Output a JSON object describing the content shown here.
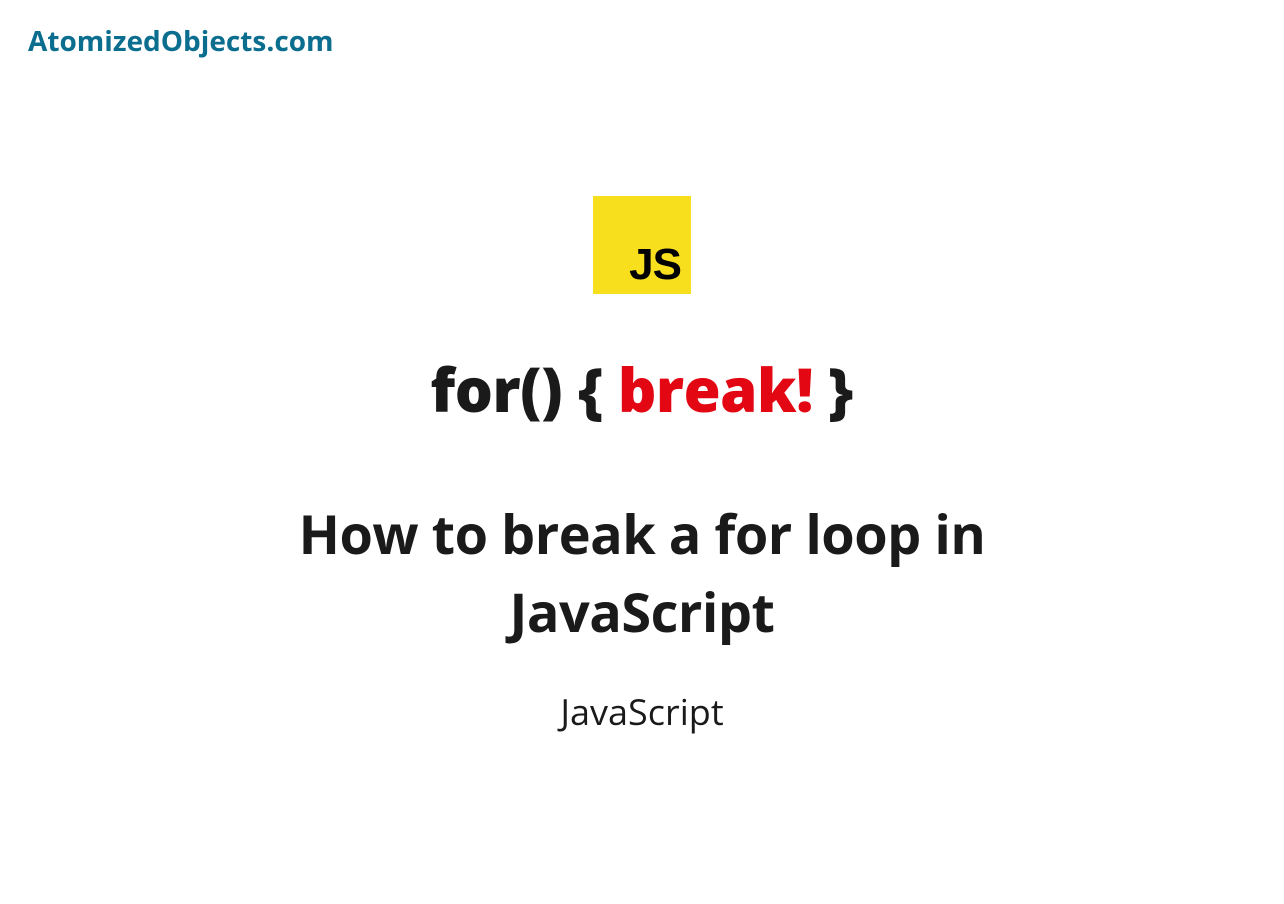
{
  "brand": {
    "name": "AtomizedObjects.com"
  },
  "logo": {
    "text": "JS"
  },
  "code": {
    "prefix": "for() { ",
    "highlight": "break!",
    "suffix": " }"
  },
  "title": "How to break a for loop in JavaScript",
  "category": "JavaScript"
}
